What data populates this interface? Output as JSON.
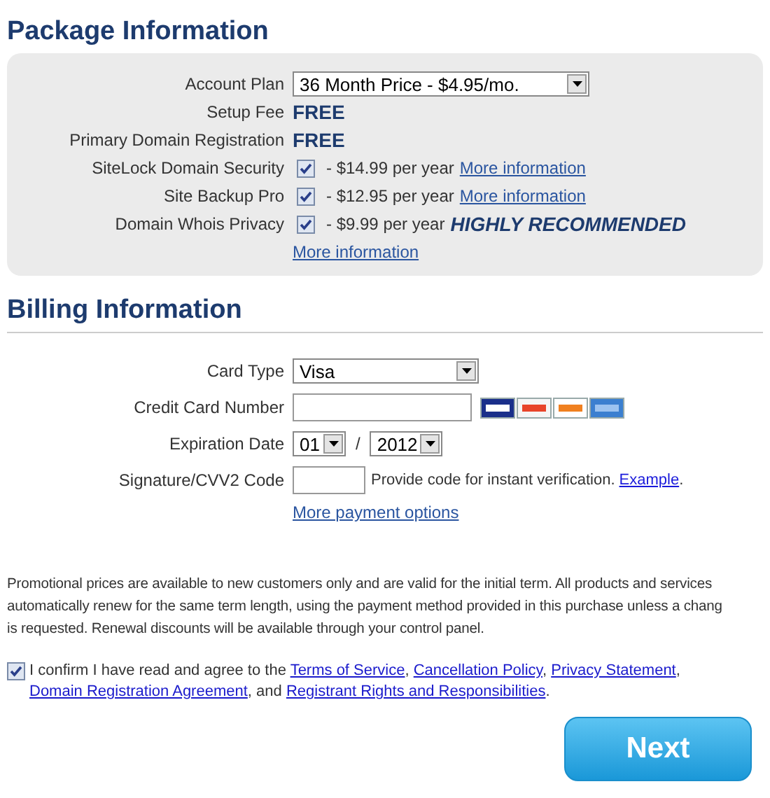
{
  "package": {
    "title": "Package Information",
    "rows": [
      {
        "kind": "select",
        "label": "Account Plan",
        "value": "36 Month Price - $4.95/mo."
      },
      {
        "kind": "free",
        "label": "Setup Fee",
        "value": "FREE"
      },
      {
        "kind": "free",
        "label": "Primary Domain Registration",
        "value": "FREE"
      },
      {
        "kind": "addon",
        "label": "SiteLock Domain Security",
        "checked": true,
        "price": "- $14.99 per year",
        "link": "More information"
      },
      {
        "kind": "addon",
        "label": "Site Backup Pro",
        "checked": true,
        "price": "- $12.95 per year",
        "link": "More information"
      },
      {
        "kind": "addon",
        "label": "Domain Whois Privacy",
        "checked": true,
        "price": "- $9.99 per year",
        "note": "HIGHLY RECOMMENDED",
        "link_below": "More information"
      }
    ]
  },
  "billing": {
    "title": "Billing Information",
    "rows": [
      {
        "kind": "select",
        "label": "Card Type",
        "value": "Visa"
      },
      {
        "kind": "card_number",
        "label": "Credit Card Number",
        "value": ""
      },
      {
        "kind": "expiry",
        "label": "Expiration Date",
        "month": "01",
        "separator": "/",
        "year": "2012"
      },
      {
        "kind": "cvv",
        "label": "Signature/CVV2 Code",
        "hint": "Provide code for instant verification.",
        "link": "Example",
        "after": "."
      }
    ],
    "more_link": "More payment options"
  },
  "promo": "Promotional prices are available to new customers only and are valid for the initial term. All products and services\nautomatically renew for the same term length, using the payment method provided in this purchase unless a chang\nis requested. Renewal discounts will be available through your control panel.",
  "agreement": {
    "checked": true,
    "parts": [
      {
        "kind": "text",
        "text": "I confirm I have read and agree to the "
      },
      {
        "kind": "link",
        "text": "Terms of Service"
      },
      {
        "kind": "text",
        "text": ", "
      },
      {
        "kind": "link",
        "text": "Cancellation Policy"
      },
      {
        "kind": "text",
        "text": ", "
      },
      {
        "kind": "link",
        "text": "Privacy Statement"
      },
      {
        "kind": "text",
        "text": ", "
      },
      {
        "kind": "link",
        "text": "Domain Registration Agreement"
      },
      {
        "kind": "text",
        "text": ", and "
      },
      {
        "kind": "link",
        "text": "Registrant Rights and Responsibilities"
      },
      {
        "kind": "text",
        "text": "."
      }
    ]
  },
  "next_button": "Next"
}
